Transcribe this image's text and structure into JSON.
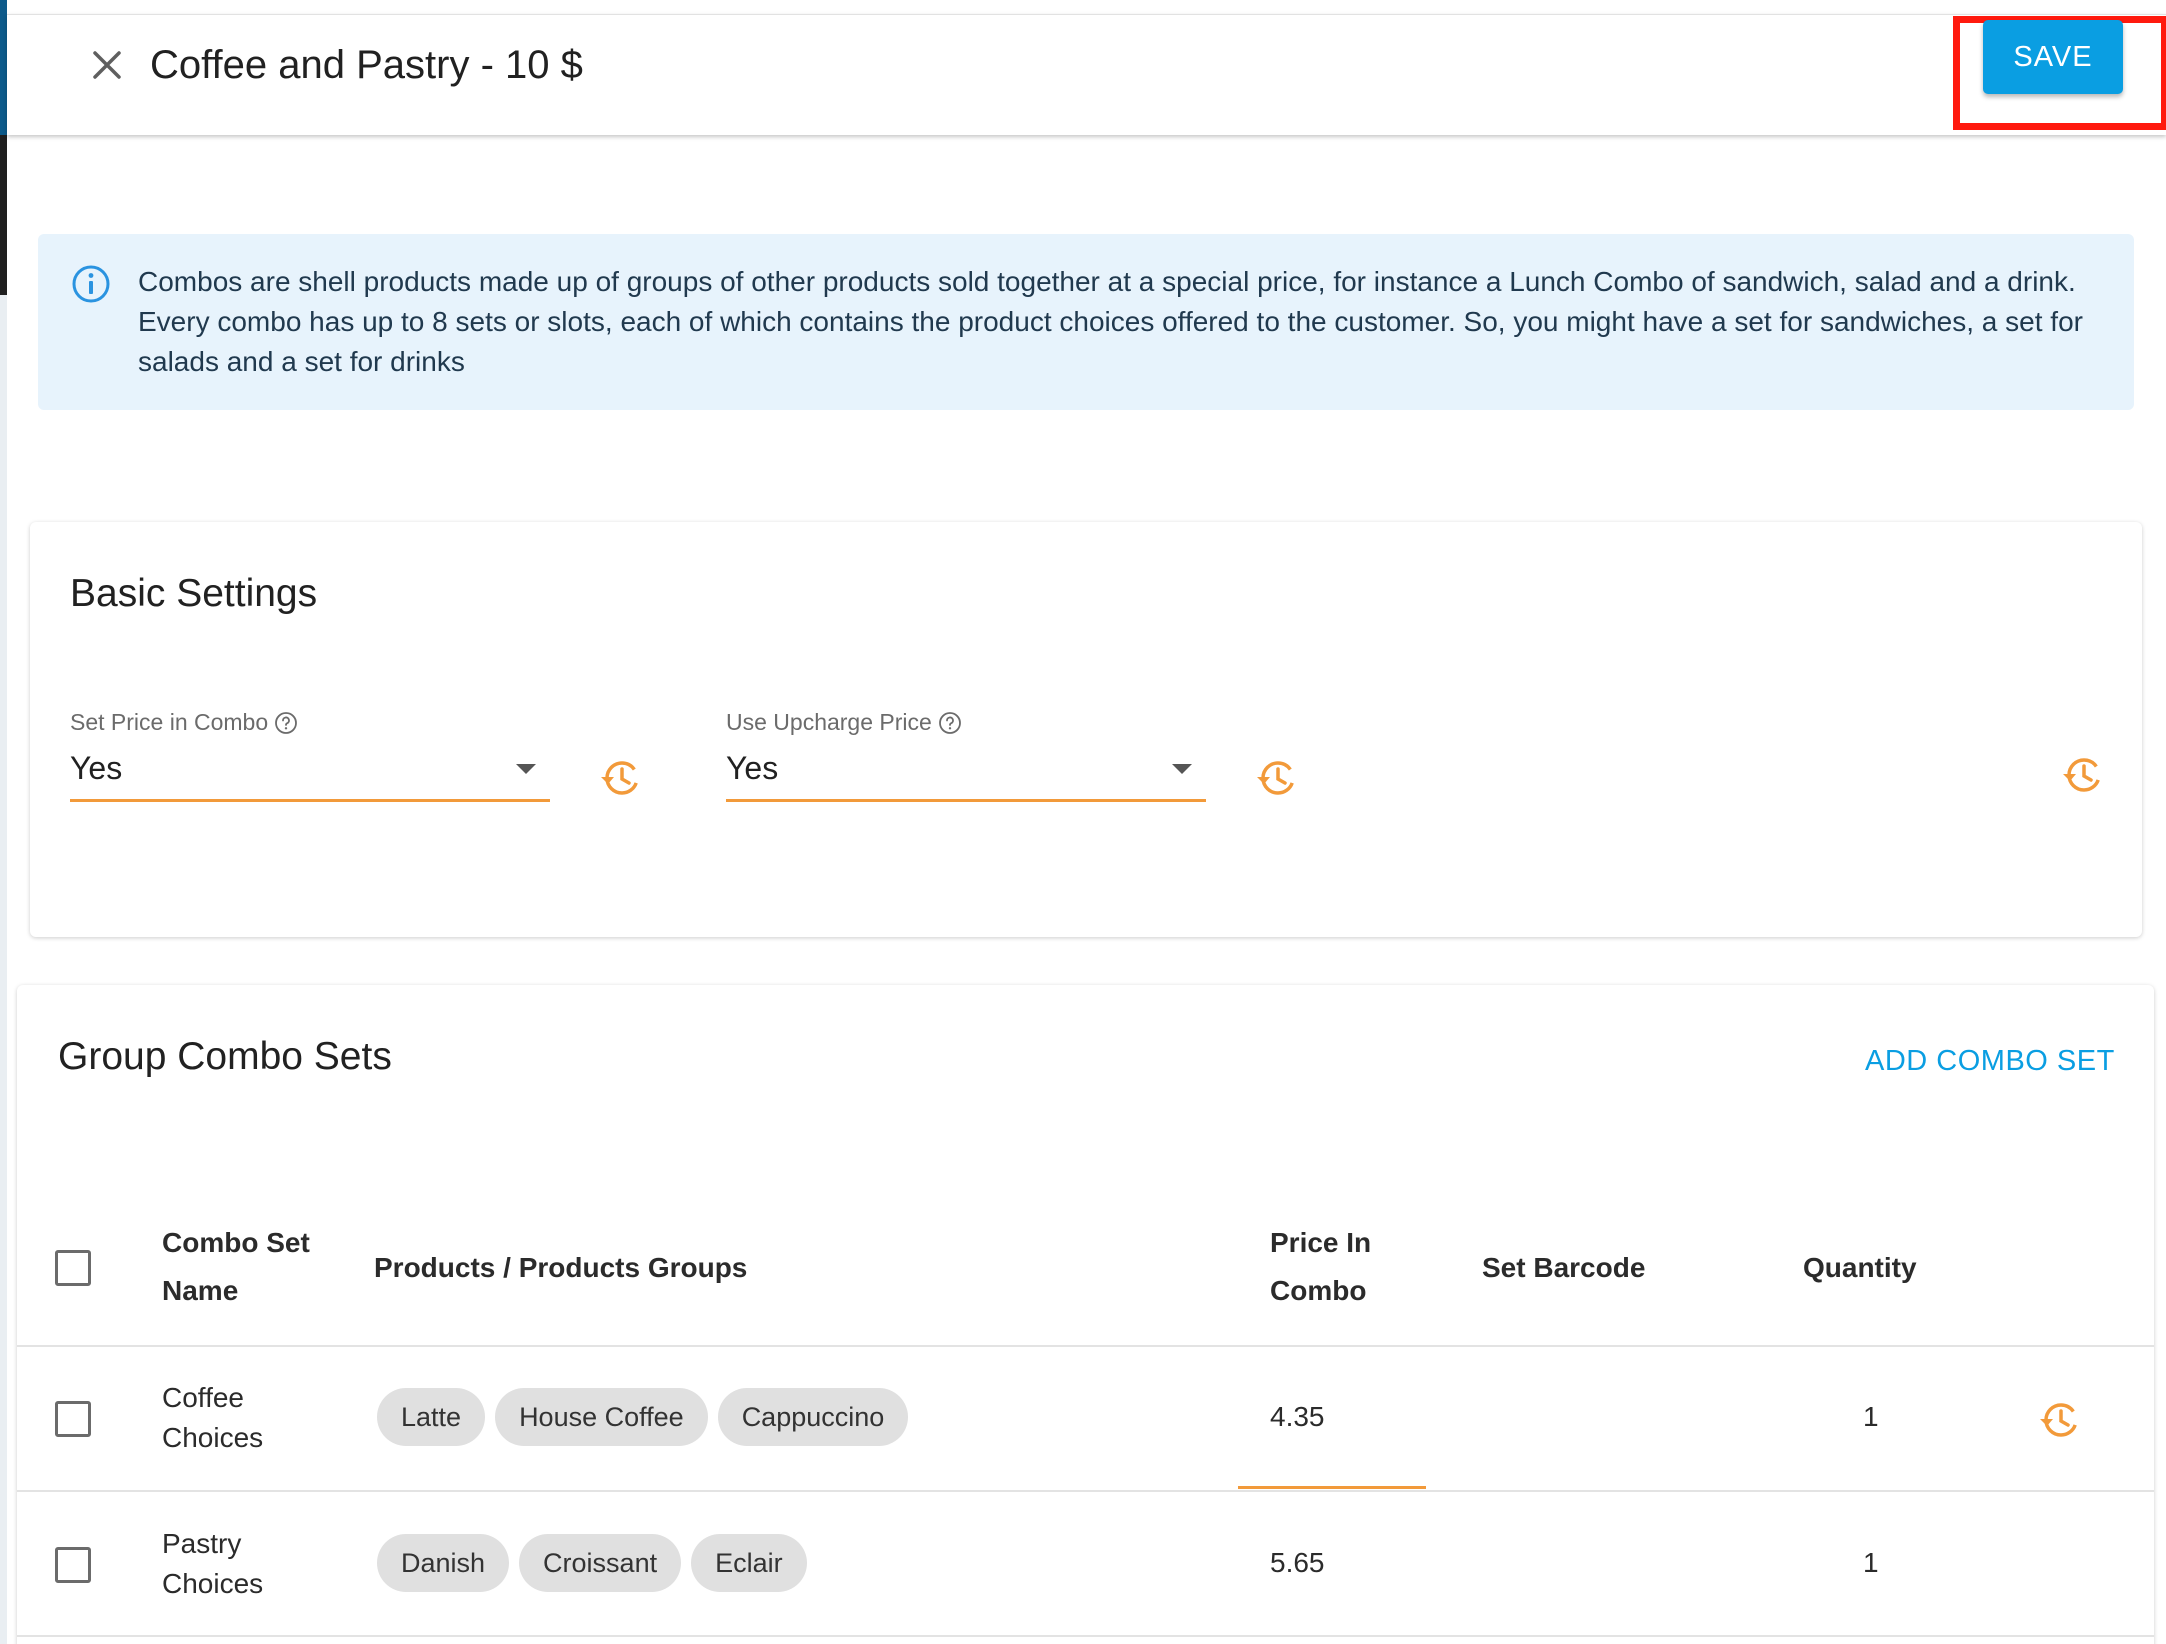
{
  "header": {
    "title": "Coffee and Pastry - 10 $",
    "save_label": "SAVE"
  },
  "info": {
    "text": "Combos are shell products made up of groups of other products sold together at a special price, for instance a Lunch Combo of sandwich, salad and a drink. Every combo has up to 8 sets or slots, each of which contains the product choices offered to the customer. So, you might have a set for sandwiches, a set for salads and a set for drinks"
  },
  "basic_settings": {
    "title": "Basic Settings",
    "fields": [
      {
        "label": "Set Price in Combo",
        "value": "Yes"
      },
      {
        "label": "Use Upcharge Price",
        "value": "Yes"
      }
    ]
  },
  "group_combo_sets": {
    "title": "Group Combo Sets",
    "add_label": "ADD COMBO SET",
    "columns": {
      "name": "Combo Set Name",
      "products": "Products / Products Groups",
      "price": "Price In Combo",
      "barcode": "Set Barcode",
      "quantity": "Quantity"
    },
    "rows": [
      {
        "name": "Coffee Choices",
        "products": [
          "Latte",
          "House Coffee",
          "Cappuccino"
        ],
        "price": "4.35",
        "barcode": "",
        "quantity": "1"
      },
      {
        "name": "Pastry Choices",
        "products": [
          "Danish",
          "Croissant",
          "Eclair"
        ],
        "price": "5.65",
        "barcode": "",
        "quantity": "1"
      }
    ]
  },
  "colors": {
    "accent": "#0a9ee2",
    "underline": "#f29a3a",
    "highlight": "#ff1a0e",
    "info_bg": "#e7f3fc"
  },
  "icons": {
    "close": "close-icon",
    "info": "info-icon",
    "help": "help-circle-icon",
    "history": "history-icon"
  }
}
